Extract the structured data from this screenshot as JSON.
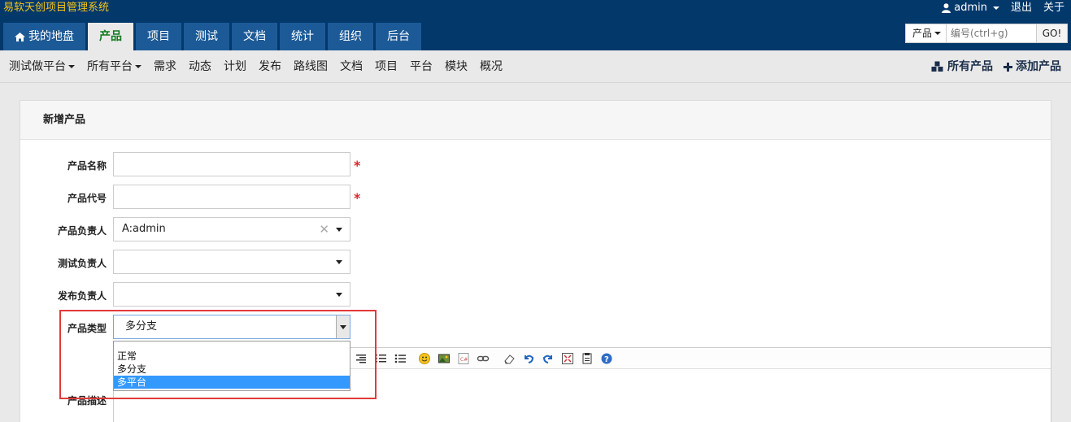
{
  "app": {
    "brand": "易软天创项目管理系统"
  },
  "user_menu": {
    "user": "admin",
    "logout": "退出",
    "about": "关于"
  },
  "main_nav": [
    {
      "label": "我的地盘",
      "icon": "home-icon"
    },
    {
      "label": "产品",
      "active": true
    },
    {
      "label": "项目"
    },
    {
      "label": "测试"
    },
    {
      "label": "文档"
    },
    {
      "label": "统计"
    },
    {
      "label": "组织"
    },
    {
      "label": "后台"
    }
  ],
  "search": {
    "type": "产品",
    "placeholder": "编号(ctrl+g)",
    "go": "GO!"
  },
  "sub_nav": {
    "left": [
      "测试做平台",
      "所有平台",
      "需求",
      "动态",
      "计划",
      "发布",
      "路线图",
      "文档",
      "项目",
      "平台",
      "模块",
      "概况"
    ],
    "right": [
      {
        "label": "所有产品",
        "icon": "cubes-icon"
      },
      {
        "label": "添加产品",
        "icon": "plus-icon"
      }
    ]
  },
  "form": {
    "title": "新增产品",
    "name_label": "产品名称",
    "code_label": "产品代号",
    "po_label": "产品负责人",
    "po_value": "A:admin",
    "qd_label": "测试负责人",
    "rd_label": "发布负责人",
    "type_label": "产品类型",
    "type_value": "多分支",
    "type_options": [
      "正常",
      "多分支",
      "多平台"
    ],
    "type_highlighted": "多平台",
    "desc_label": "产品描述",
    "required_mark": "*"
  },
  "colors": {
    "header": "#03386b",
    "tab": "#1c5a97",
    "active_tab_text": "#0f7a1c",
    "highlight_border": "#e23a3a",
    "selected_option": "#3399ff"
  }
}
